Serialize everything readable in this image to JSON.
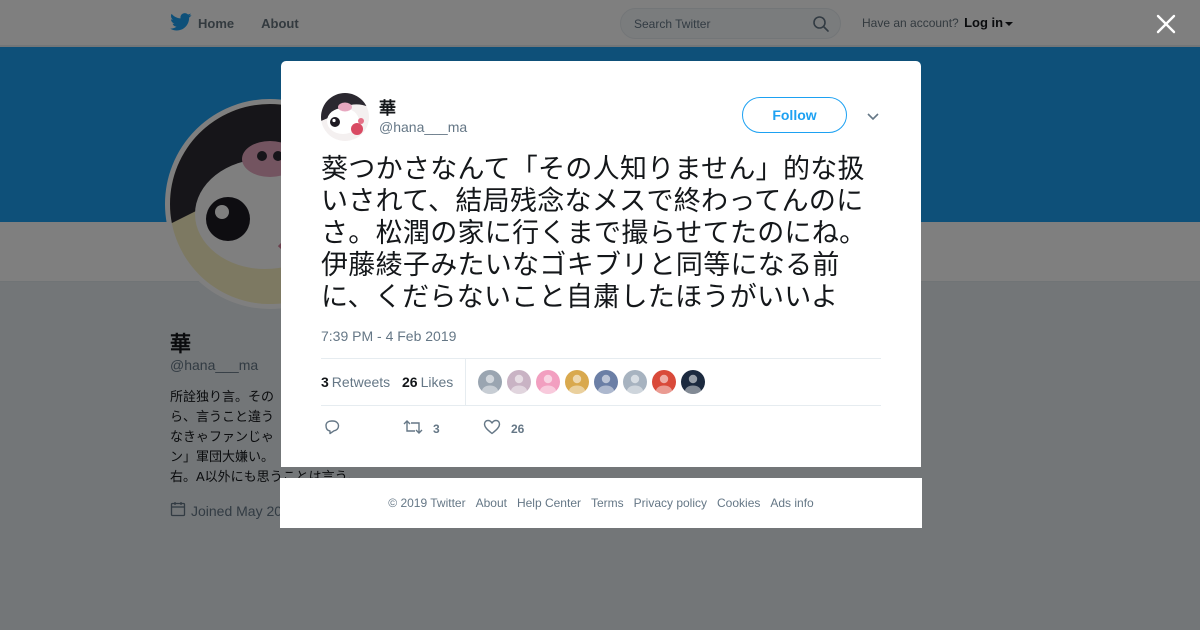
{
  "topbar": {
    "home_label": "Home",
    "about_label": "About",
    "search_placeholder": "Search Twitter",
    "have_account": "Have an account?",
    "login_label": "Log in"
  },
  "profile": {
    "name": "華",
    "handle": "@hana___ma",
    "bio_visible": "所詮独り言。その\nら、言うこと違う\nなきゃファンじゃ\nン」軍団大嫌い。\n右。A以外にも思うことは言う。",
    "joined": "Joined May 20"
  },
  "tweet": {
    "name": "華",
    "handle": "@hana___ma",
    "follow_label": "Follow",
    "text": "葵つかさなんて「その人知りません」的な扱いされて、結局残念なメスで終わってんのにさ。松潤の家に行くまで撮らせてたのにね。伊藤綾子みたいなゴキブリと同等になる前に、くだらないこと自粛したほうがいいよ",
    "timestamp": "7:39 PM - 4 Feb 2019",
    "retweets_count": "3",
    "retweets_label": "Retweets",
    "likes_count": "26",
    "likes_label": "Likes",
    "action_retweet_count": "3",
    "action_like_count": "26",
    "likers": [
      {
        "name": "liker-1",
        "color": "#9aa5b1"
      },
      {
        "name": "liker-2",
        "color": "#c9b3c4"
      },
      {
        "name": "liker-3",
        "color": "#f29fc0"
      },
      {
        "name": "liker-4",
        "color": "#d9a94e"
      },
      {
        "name": "liker-5",
        "color": "#6b7fa6"
      },
      {
        "name": "liker-6",
        "color": "#a7b3c0"
      },
      {
        "name": "liker-7",
        "color": "#d94a3a"
      },
      {
        "name": "liker-8",
        "color": "#1c2a3f"
      }
    ]
  },
  "footer": {
    "items": [
      "© 2019 Twitter",
      "About",
      "Help Center",
      "Terms",
      "Privacy policy",
      "Cookies",
      "Ads info"
    ]
  },
  "colors": {
    "brand_blue": "#1da1f2",
    "overlay": "rgba(0,0,0,0.5)"
  }
}
